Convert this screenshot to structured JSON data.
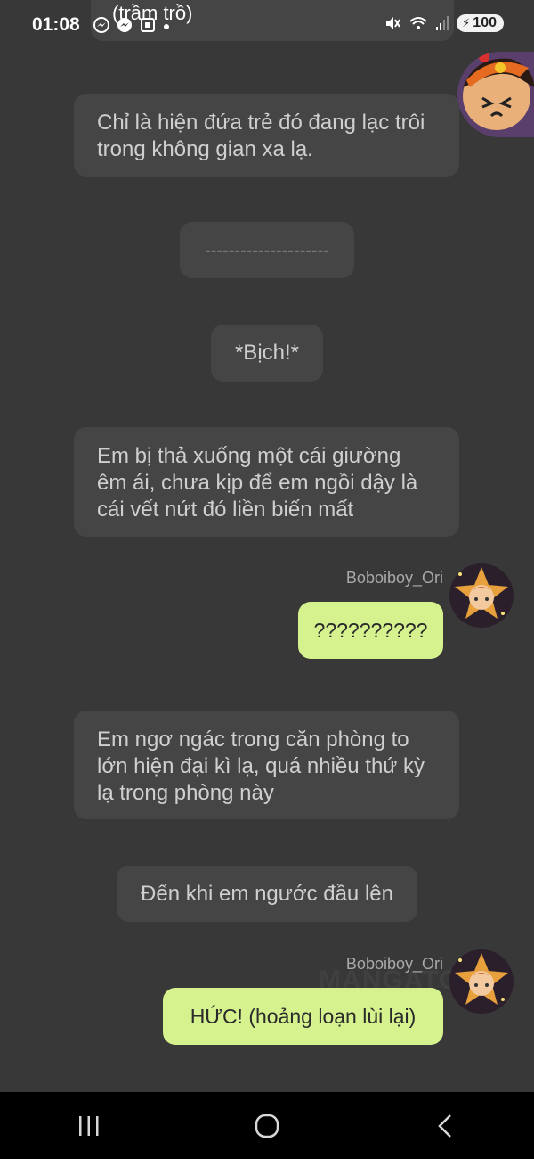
{
  "status_bar": {
    "time": "01:08",
    "battery": "100",
    "icons": [
      "messenger-icon",
      "messenger-icon",
      "screenshot-icon",
      "dot-icon",
      "mute-icon",
      "wifi-icon",
      "signal-icon",
      "battery-icon"
    ]
  },
  "messages": [
    {
      "type": "narration",
      "text": "(trầm trồ)"
    },
    {
      "type": "narration",
      "text": "Chỉ là hiện đứa trẻ đó đang lạc trôi trong không gian xa lạ."
    },
    {
      "type": "narration",
      "text": "---------------------"
    },
    {
      "type": "narration",
      "text": "*Bịch!*"
    },
    {
      "type": "narration",
      "text": "Em bị thả xuống một cái giường êm ái, chưa kịp để em ngồi dậy là cái vết nứt đó liền biến mất"
    },
    {
      "type": "user",
      "username": "Boboiboy_Ori",
      "text": "??????????"
    },
    {
      "type": "narration",
      "text": "Em ngơ ngác trong căn phòng to lớn hiện đại kì lạ, quá nhiều thứ kỳ lạ trong phòng này"
    },
    {
      "type": "narration",
      "text": "Đến khi em ngước đầu lên"
    },
    {
      "type": "user",
      "username": "Boboiboy_Ori",
      "text": "HỨC! (hoảng loạn lùi lại)"
    }
  ],
  "watermark": "MANGATO",
  "colors": {
    "background": "#383838",
    "bubble": "#454545",
    "user_bubble": "#d5f28f",
    "navbar": "#000000"
  },
  "navbar": {
    "buttons": [
      "recent-apps-icon",
      "home-icon",
      "back-icon"
    ]
  }
}
